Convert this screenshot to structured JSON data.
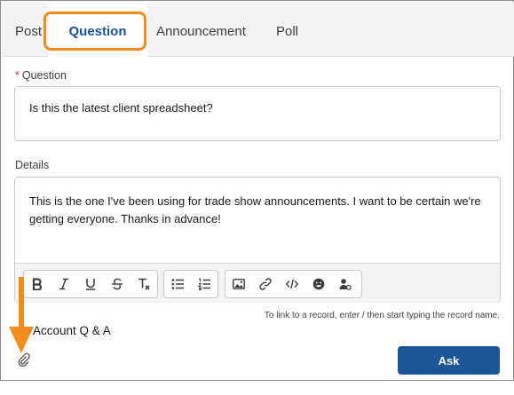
{
  "tabs": [
    {
      "label": "Post"
    },
    {
      "label": "Question"
    },
    {
      "label": "Announcement"
    },
    {
      "label": "Poll"
    }
  ],
  "question": {
    "required_mark": "*",
    "label": "Question",
    "value": "Is this the latest client spreadsheet?"
  },
  "details": {
    "label": "Details",
    "value": "This is the one I've been using for trade show announcements. I want to be certain we're getting everyone. Thanks in advance!"
  },
  "toolbar": {
    "buttons": [
      "bold",
      "italic",
      "underline",
      "strikethrough",
      "clear-formatting",
      "bulleted-list",
      "numbered-list",
      "image",
      "link",
      "code",
      "emoji",
      "mention"
    ]
  },
  "hint": "To link to a record, enter / then start typing the record name.",
  "group": "Account Q & A",
  "ask_button": "Ask",
  "colors": {
    "accent": "#1d5597",
    "highlight": "#f28c1c"
  }
}
